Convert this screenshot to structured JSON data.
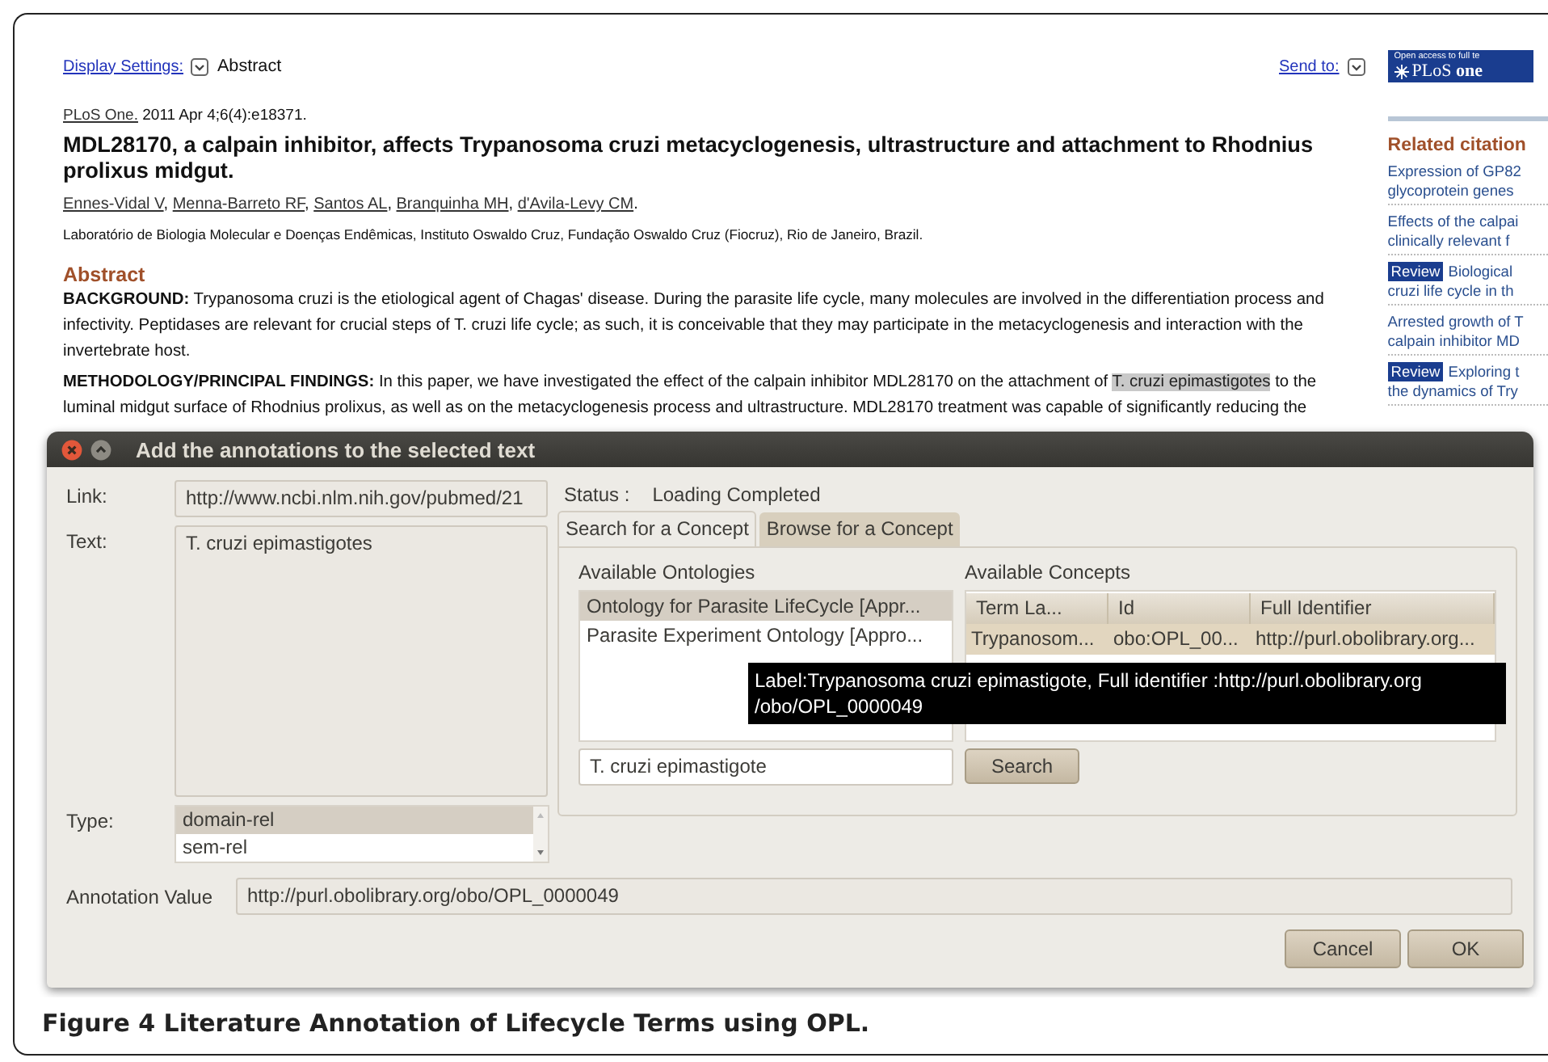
{
  "web_page": {
    "display_settings": {
      "link": "Display Settings:",
      "value": "Abstract"
    },
    "send_to": {
      "link": "Send to:"
    },
    "journal_logo": {
      "tagline": "Open access to full te",
      "name": "PLoS **one**"
    },
    "citation": {
      "journal": "PLoS One.",
      "date": " 2011 Apr 4;6(4):e18371."
    },
    "title": "MDL28170, a calpain inhibitor, affects Trypanosoma cruzi metacyclogenesis, ultrastructure and attachment to Rhodnius prolixus midgut.",
    "authors": [
      {
        "name": "Ennes-Vidal V",
        "punct": ", "
      },
      {
        "name": "Menna-Barreto RF",
        "punct": ", "
      },
      {
        "name": "Santos AL",
        "punct": ", "
      },
      {
        "name": "Branquinha MH",
        "punct": ", "
      },
      {
        "name": "d'Avila-Levy CM",
        "punct": "."
      }
    ],
    "affiliation": "Laboratório de Biologia Molecular e Doenças Endêmicas, Instituto Oswaldo Cruz, Fundação Oswaldo Cruz (Fiocruz), Rio de Janeiro, Brazil.",
    "abstract_heading": "Abstract",
    "paragraphs": [
      {
        "lead": "BACKGROUND:",
        "before": " Trypanosoma cruzi is the etiological agent of Chagas' disease. During the parasite life cycle, many molecules are involved in the differentiation process and infectivity. Peptidases are relevant for crucial steps of T. cruzi life cycle; as such, it is conceivable that they may participate in the metacyclogenesis and interaction with the invertebrate host."
      },
      {
        "lead": "METHODOLOGY/PRINCIPAL FINDINGS:",
        "before": " In this paper, we have investigated the effect of the calpain inhibitor MDL28170 on the attachment of ",
        "highlight": "T. cruzi epimastigotes",
        "after": " to the luminal midgut surface of Rhodnius prolixus, as well as on the metacyclogenesis process and ultrastructure. MDL28170 treatment was capable of significantly reducing the"
      }
    ],
    "related": {
      "heading": "Related citation",
      "items": [
        {
          "lines": [
            "Expression of GP82",
            "glycoprotein genes"
          ]
        },
        {
          "lines": [
            "Effects of the calpai",
            "clinically relevant f"
          ]
        },
        {
          "badge": "Review",
          "lines": [
            "Biological",
            "cruzi life cycle in th"
          ]
        },
        {
          "lines": [
            "Arrested growth of T",
            "calpain inhibitor MD"
          ]
        },
        {
          "badge": "Review",
          "lines": [
            "Exploring t",
            "the dynamics of Try"
          ]
        }
      ]
    }
  },
  "dialog": {
    "title": "Add the annotations to the selected text",
    "link": {
      "label": "Link:",
      "value": "http://www.ncbi.nlm.nih.gov/pubmed/21"
    },
    "text": {
      "label": "Text:",
      "value": "T. cruzi epimastigotes"
    },
    "type": {
      "label": "Type:",
      "options": [
        {
          "label": "domain-rel",
          "selected": true
        },
        {
          "label": "sem-rel",
          "selected": false
        }
      ]
    },
    "status": {
      "label": "Status :",
      "value": "Loading Completed"
    },
    "tabs": [
      {
        "label": "Search for a Concept",
        "selected": true
      },
      {
        "label": "Browse for a Concept",
        "selected": false
      }
    ],
    "ontologies": {
      "label": "Available Ontologies",
      "items": [
        {
          "label": "Ontology for Parasite LifeCycle [Appr...",
          "selected": true
        },
        {
          "label": "Parasite Experiment Ontology [Appro...",
          "selected": false
        }
      ]
    },
    "search": {
      "value": "T. cruzi epimastigote",
      "button": "Search"
    },
    "concepts": {
      "label": "Available Concepts",
      "columns": [
        "Term La...",
        "Id",
        "Full Identifier"
      ],
      "rows": [
        {
          "cells": [
            "Trypanosom...",
            "obo:OPL_00...",
            "http://purl.obolibrary.org..."
          ],
          "selected": true
        }
      ]
    },
    "tooltip": {
      "lines": [
        "Label:Trypanosoma cruzi epimastigote, Full identifier :http://purl.obolibrary.org",
        "/obo/OPL_0000049"
      ]
    },
    "annotation_value": {
      "label": "Annotation Value",
      "value": "http://purl.obolibrary.org/obo/OPL_0000049"
    },
    "buttons": [
      "Cancel",
      "OK"
    ]
  },
  "caption": "Figure 4 Literature Annotation of Lifecycle Terms using OPL."
}
